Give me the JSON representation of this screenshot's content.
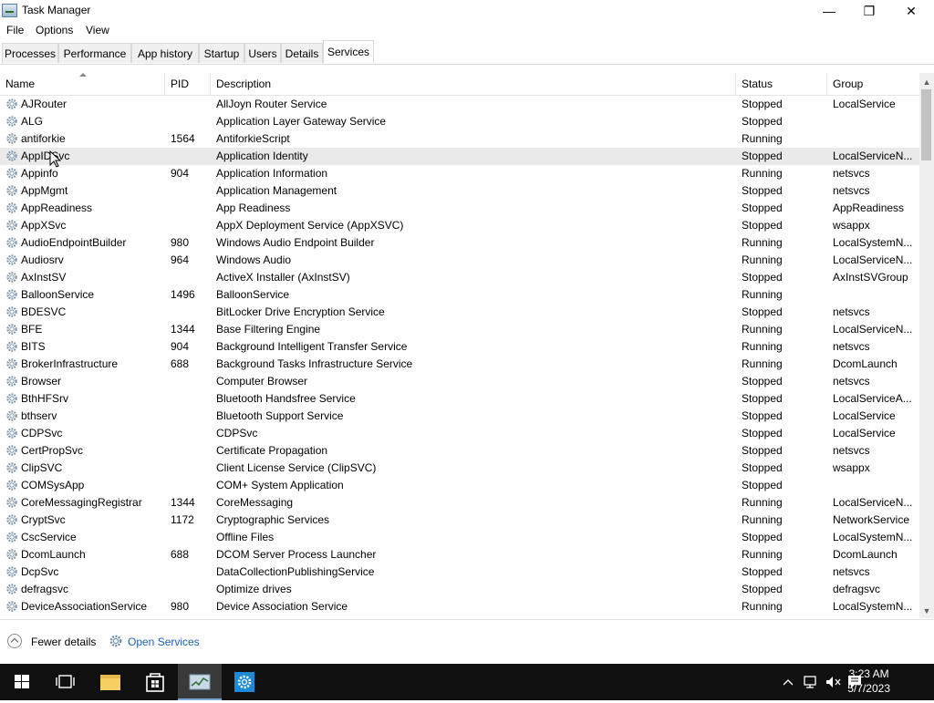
{
  "window": {
    "title": "Task Manager",
    "minimize": "—",
    "maximize": "❐",
    "close": "✕"
  },
  "menu": [
    "File",
    "Options",
    "View"
  ],
  "tabs": [
    "Processes",
    "Performance",
    "App history",
    "Startup",
    "Users",
    "Details",
    "Services"
  ],
  "active_tab": "Services",
  "columns": [
    "Name",
    "PID",
    "Description",
    "Status",
    "Group"
  ],
  "rows": [
    {
      "name": "AJRouter",
      "pid": "",
      "desc": "AllJoyn Router Service",
      "status": "Stopped",
      "group": "LocalService"
    },
    {
      "name": "ALG",
      "pid": "",
      "desc": "Application Layer Gateway Service",
      "status": "Stopped",
      "group": ""
    },
    {
      "name": "antiforkie",
      "pid": "1564",
      "desc": "AntiforkieScript",
      "status": "Running",
      "group": ""
    },
    {
      "name": "AppIDSvc",
      "pid": "",
      "desc": "Application Identity",
      "status": "Stopped",
      "group": "LocalServiceN..."
    },
    {
      "name": "Appinfo",
      "pid": "904",
      "desc": "Application Information",
      "status": "Running",
      "group": "netsvcs"
    },
    {
      "name": "AppMgmt",
      "pid": "",
      "desc": "Application Management",
      "status": "Stopped",
      "group": "netsvcs"
    },
    {
      "name": "AppReadiness",
      "pid": "",
      "desc": "App Readiness",
      "status": "Stopped",
      "group": "AppReadiness"
    },
    {
      "name": "AppXSvc",
      "pid": "",
      "desc": "AppX Deployment Service (AppXSVC)",
      "status": "Stopped",
      "group": "wsappx"
    },
    {
      "name": "AudioEndpointBuilder",
      "pid": "980",
      "desc": "Windows Audio Endpoint Builder",
      "status": "Running",
      "group": "LocalSystemN..."
    },
    {
      "name": "Audiosrv",
      "pid": "964",
      "desc": "Windows Audio",
      "status": "Running",
      "group": "LocalServiceN..."
    },
    {
      "name": "AxInstSV",
      "pid": "",
      "desc": "ActiveX Installer (AxInstSV)",
      "status": "Stopped",
      "group": "AxInstSVGroup"
    },
    {
      "name": "BalloonService",
      "pid": "1496",
      "desc": "BalloonService",
      "status": "Running",
      "group": ""
    },
    {
      "name": "BDESVC",
      "pid": "",
      "desc": "BitLocker Drive Encryption Service",
      "status": "Stopped",
      "group": "netsvcs"
    },
    {
      "name": "BFE",
      "pid": "1344",
      "desc": "Base Filtering Engine",
      "status": "Running",
      "group": "LocalServiceN..."
    },
    {
      "name": "BITS",
      "pid": "904",
      "desc": "Background Intelligent Transfer Service",
      "status": "Running",
      "group": "netsvcs"
    },
    {
      "name": "BrokerInfrastructure",
      "pid": "688",
      "desc": "Background Tasks Infrastructure Service",
      "status": "Running",
      "group": "DcomLaunch"
    },
    {
      "name": "Browser",
      "pid": "",
      "desc": "Computer Browser",
      "status": "Stopped",
      "group": "netsvcs"
    },
    {
      "name": "BthHFSrv",
      "pid": "",
      "desc": "Bluetooth Handsfree Service",
      "status": "Stopped",
      "group": "LocalServiceA..."
    },
    {
      "name": "bthserv",
      "pid": "",
      "desc": "Bluetooth Support Service",
      "status": "Stopped",
      "group": "LocalService"
    },
    {
      "name": "CDPSvc",
      "pid": "",
      "desc": "CDPSvc",
      "status": "Stopped",
      "group": "LocalService"
    },
    {
      "name": "CertPropSvc",
      "pid": "",
      "desc": "Certificate Propagation",
      "status": "Stopped",
      "group": "netsvcs"
    },
    {
      "name": "ClipSVC",
      "pid": "",
      "desc": "Client License Service (ClipSVC)",
      "status": "Stopped",
      "group": "wsappx"
    },
    {
      "name": "COMSysApp",
      "pid": "",
      "desc": "COM+ System Application",
      "status": "Stopped",
      "group": ""
    },
    {
      "name": "CoreMessagingRegistrar",
      "pid": "1344",
      "desc": "CoreMessaging",
      "status": "Running",
      "group": "LocalServiceN..."
    },
    {
      "name": "CryptSvc",
      "pid": "1172",
      "desc": "Cryptographic Services",
      "status": "Running",
      "group": "NetworkService"
    },
    {
      "name": "CscService",
      "pid": "",
      "desc": "Offline Files",
      "status": "Stopped",
      "group": "LocalSystemN..."
    },
    {
      "name": "DcomLaunch",
      "pid": "688",
      "desc": "DCOM Server Process Launcher",
      "status": "Running",
      "group": "DcomLaunch"
    },
    {
      "name": "DcpSvc",
      "pid": "",
      "desc": "DataCollectionPublishingService",
      "status": "Stopped",
      "group": "netsvcs"
    },
    {
      "name": "defragsvc",
      "pid": "",
      "desc": "Optimize drives",
      "status": "Stopped",
      "group": "defragsvc"
    },
    {
      "name": "DeviceAssociationService",
      "pid": "980",
      "desc": "Device Association Service",
      "status": "Running",
      "group": "LocalSystemN..."
    }
  ],
  "selected_row": 3,
  "footer": {
    "fewer_details": "Fewer details",
    "open_services": "Open Services"
  },
  "clock": {
    "time": "3:23 AM",
    "date": "5/7/2023"
  },
  "colors": {
    "link": "#1a62b8",
    "taskbar": "#101010",
    "active_app": "#1e8ad6"
  }
}
